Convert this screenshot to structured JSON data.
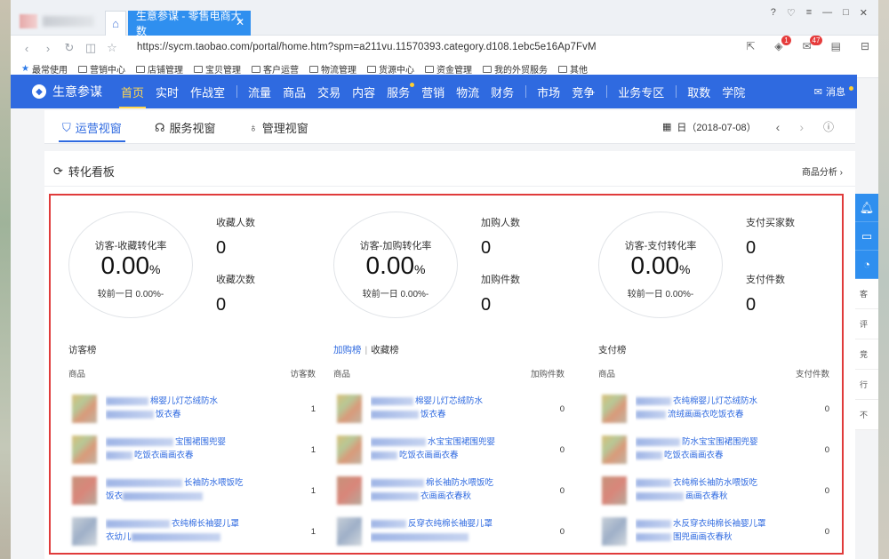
{
  "browser": {
    "tab_title": "生意参谋 - 零售电商大数",
    "url": "https://sycm.taobao.com/portal/home.htm?spm=a211vu.11570393.category.d108.1ebc5e16Ap7FvM",
    "mail_badge": "47",
    "shield_badge": "1",
    "bookmarks": [
      "最常使用",
      "营销中心",
      "店铺管理",
      "宝贝管理",
      "客户运营",
      "物流管理",
      "货源中心",
      "资金管理",
      "我的外贸服务",
      "其他"
    ]
  },
  "nav": {
    "logo": "生意参谋",
    "items_a": [
      "首页",
      "实时",
      "作战室"
    ],
    "items_b": [
      "流量",
      "商品",
      "交易",
      "内容",
      "服务",
      "营销",
      "物流",
      "财务"
    ],
    "items_c": [
      "市场",
      "竞争"
    ],
    "items_d": [
      "业务专区"
    ],
    "items_e": [
      "取数",
      "学院"
    ],
    "message": "消息"
  },
  "subtabs": {
    "tab1": "运营视窗",
    "tab2": "服务视窗",
    "tab3": "管理视窗",
    "date": "日（2018-07-08）"
  },
  "card": {
    "title": "转化看板",
    "link": "商品分析",
    "groups": [
      {
        "rate_label": "访客-收藏转化率",
        "rate_value": "0.00",
        "comp": "较前一日  0.00%-",
        "m1_name": "收藏人数",
        "m1_val": "0",
        "m2_name": "收藏次数",
        "m2_val": "0"
      },
      {
        "rate_label": "访客-加购转化率",
        "rate_value": "0.00",
        "comp": "较前一日  0.00%-",
        "m1_name": "加购人数",
        "m1_val": "0",
        "m2_name": "加购件数",
        "m2_val": "0"
      },
      {
        "rate_label": "访客-支付转化率",
        "rate_value": "0.00",
        "comp": "较前一日  0.00%-",
        "m1_name": "支付买家数",
        "m1_val": "0",
        "m2_name": "支付件数",
        "m2_val": "0"
      }
    ],
    "percent": "%",
    "rankings": [
      {
        "title": "访客榜",
        "col1": "商品",
        "col2": "访客数",
        "rows": [
          {
            "text1": "棉婴儿灯芯绒防水",
            "text2": "饭衣春",
            "count": "1"
          },
          {
            "text1": "宝围裙围兜婴",
            "text2": "吃饭衣画画衣春",
            "count": "1"
          },
          {
            "text1": "长袖防水喂饭吃",
            "text2": "饭衣",
            "count": "1"
          },
          {
            "text1": "衣纯棉长袖婴儿罩",
            "text2": "衣幼儿",
            "count": "1"
          }
        ]
      },
      {
        "title_link": "加购榜",
        "title": "收藏榜",
        "col1": "商品",
        "col2": "加购件数",
        "rows": [
          {
            "text1": "棉婴儿灯芯绒防水",
            "text2": "饭衣春",
            "count": "0"
          },
          {
            "text1": "水宝宝围裙围兜婴",
            "text2": "吃饭衣画画衣春",
            "count": "0"
          },
          {
            "text1": "棉长袖防水喂饭吃",
            "text2": "衣画画衣春秋",
            "count": "0"
          },
          {
            "text1": "反穿衣纯棉长袖婴儿罩",
            "text2": "",
            "count": "0"
          }
        ]
      },
      {
        "title": "支付榜",
        "col1": "商品",
        "col2": "支付件数",
        "rows": [
          {
            "text1": "衣纯棉婴儿灯芯绒防水",
            "text2": "流绒画画衣吃饭衣春",
            "count": "0"
          },
          {
            "text1": "防水宝宝围裙围兜婴",
            "text2": "吃饭衣画画衣春",
            "count": "0"
          },
          {
            "text1": "衣纯棉长袖防水喂饭吃",
            "text2": "画画衣春秋",
            "count": "0"
          },
          {
            "text1": "水反穿衣纯棉长袖婴儿罩",
            "text2": "围兜画画衣春秋",
            "count": "0"
          }
        ]
      }
    ]
  },
  "side": {
    "items": [
      "客",
      "评",
      "竞",
      "行",
      "不"
    ]
  },
  "colors": {
    "primary": "#2f6ae0",
    "highlight": "#ffd750",
    "alert": "#e03b3b"
  }
}
